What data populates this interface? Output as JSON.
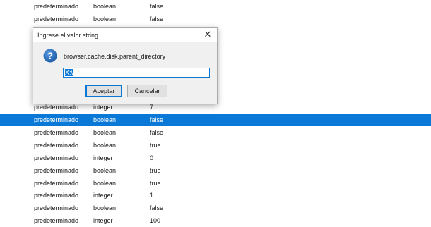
{
  "rows": [
    {
      "state": "predeterminado",
      "type": "boolean",
      "value": "false"
    },
    {
      "state": "predeterminado",
      "type": "boolean",
      "value": "false"
    },
    {
      "state": "predeterminado",
      "type": "integer",
      "value": "7"
    },
    {
      "state": "predeterminado",
      "type": "boolean",
      "value": "false"
    },
    {
      "state": "predeterminado",
      "type": "boolean",
      "value": "false"
    },
    {
      "state": "predeterminado",
      "type": "boolean",
      "value": "true"
    },
    {
      "state": "predeterminado",
      "type": "integer",
      "value": "0"
    },
    {
      "state": "predeterminado",
      "type": "boolean",
      "value": "true"
    },
    {
      "state": "predeterminado",
      "type": "boolean",
      "value": "true"
    },
    {
      "state": "predeterminado",
      "type": "integer",
      "value": "1"
    },
    {
      "state": "predeterminado",
      "type": "boolean",
      "value": "false"
    },
    {
      "state": "predeterminado",
      "type": "integer",
      "value": "100"
    }
  ],
  "selected_row": 3,
  "dialog": {
    "title": "Ingrese el valor string",
    "close_glyph": "✕",
    "message": "browser.cache.disk.parent_directory",
    "input_value": "X:\\",
    "accept_label": "Aceptar",
    "cancel_label": "Cancelar"
  },
  "colors": {
    "selection": "#0a78d7",
    "question_icon": "#1f5ca8"
  },
  "icons": {
    "dialog": "question-icon"
  }
}
